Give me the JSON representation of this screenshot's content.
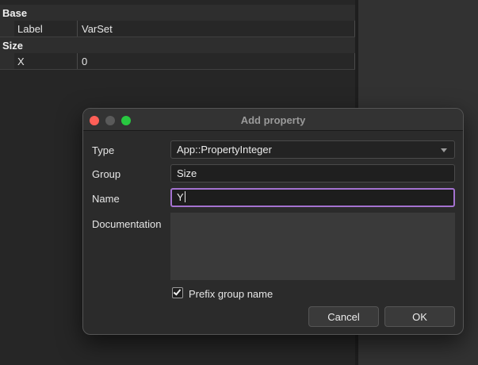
{
  "property_editor": {
    "groups": [
      {
        "name": "Base",
        "properties": [
          {
            "name": "Label",
            "value": "VarSet"
          }
        ]
      },
      {
        "name": "Size",
        "properties": [
          {
            "name": "X",
            "value": "0"
          }
        ]
      }
    ]
  },
  "dialog": {
    "title": "Add property",
    "type_label": "Type",
    "type_value": "App::PropertyInteger",
    "group_label": "Group",
    "group_value": "Size",
    "name_label": "Name",
    "name_value": "Y",
    "documentation_label": "Documentation",
    "documentation_value": "",
    "prefix_label": "Prefix group name",
    "prefix_checked": true,
    "cancel_label": "Cancel",
    "ok_label": "OK"
  },
  "colors": {
    "accent_focus": "#a472d0",
    "close_button": "#ff5f57",
    "zoom_button": "#28c840"
  }
}
